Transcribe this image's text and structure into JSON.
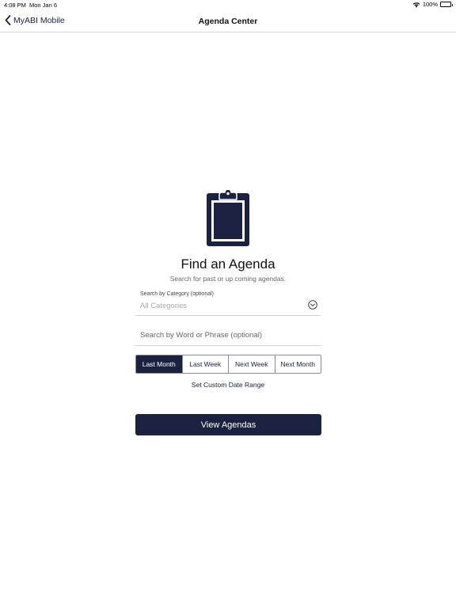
{
  "status_bar": {
    "time": "4:08 PM",
    "date": "Mon Jan 6",
    "battery": "100%"
  },
  "nav": {
    "back_label": "MyABI Mobile",
    "title": "Agenda Center"
  },
  "main": {
    "heading": "Find an Agenda",
    "subheading": "Search for past or up coming agendas.",
    "category": {
      "caption": "Search by Category (optional)",
      "value": "All Categories"
    },
    "search": {
      "placeholder": "Search by Word or Phrase (optional)"
    },
    "date_ranges": [
      {
        "label": "Last Month",
        "selected": true
      },
      {
        "label": "Last Week",
        "selected": false
      },
      {
        "label": "Next Week",
        "selected": false
      },
      {
        "label": "Next Month",
        "selected": false
      }
    ],
    "custom_range_label": "Set Custom Date Range",
    "view_button_label": "View Agendas"
  },
  "colors": {
    "primary": "#1b2140",
    "divider": "#cfcfcf",
    "muted_text": "#a8a8a8"
  },
  "icons": [
    "wifi-icon",
    "battery-icon",
    "chevron-left-icon",
    "clipboard-icon",
    "chevron-down-circle-icon"
  ]
}
